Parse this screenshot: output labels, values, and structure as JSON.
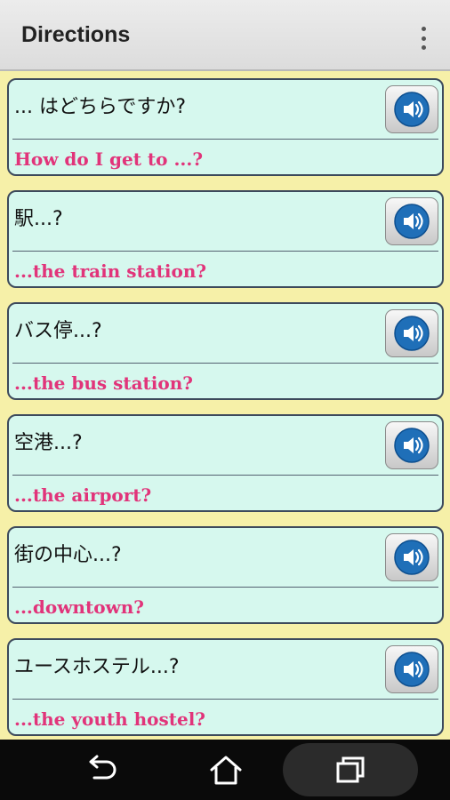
{
  "appbar": {
    "title": "Directions",
    "menu_icon": "overflow-menu-icon"
  },
  "phrases": [
    {
      "jp": "... はどちらですか?",
      "en": "How do I get to ...?"
    },
    {
      "jp": "駅...?",
      "en": "...the train station?"
    },
    {
      "jp": "バス停...?",
      "en": "...the bus station?"
    },
    {
      "jp": "空港...?",
      "en": "...the airport?"
    },
    {
      "jp": "街の中心...?",
      "en": "...downtown?"
    },
    {
      "jp": "ユースホステル...?",
      "en": "...the youth hostel?"
    }
  ],
  "colors": {
    "card_bg": "#d6f8ee",
    "list_bg": "#f6f0a8",
    "english_text": "#e1347a",
    "speaker_blue": "#1f6fb8"
  },
  "navbar": {
    "back_icon": "back-icon",
    "home_icon": "home-icon",
    "recents_icon": "recents-icon"
  }
}
